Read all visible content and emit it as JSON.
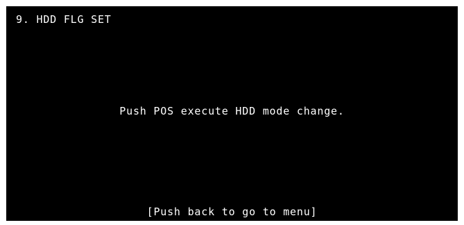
{
  "screen": {
    "title": "9. HDD FLG SET",
    "message": "Push POS execute HDD mode change.",
    "footer": "[Push back to go to menu]"
  },
  "colors": {
    "background": "#000000",
    "text": "#ffffff",
    "border": "#ffffff"
  }
}
